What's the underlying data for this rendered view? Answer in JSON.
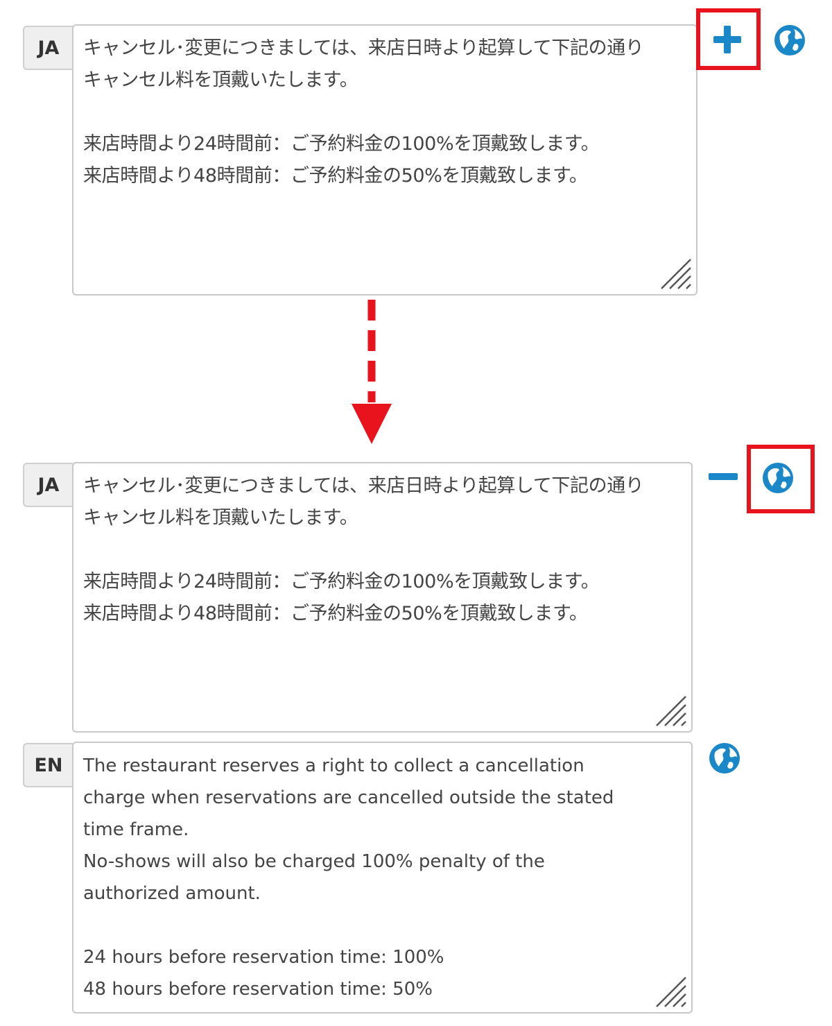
{
  "colors": {
    "highlight": "#e8131d",
    "arrow": "#e8131d",
    "icon": "#1a87c9",
    "tag_bg": "#efefef",
    "border": "#c8c8c8"
  },
  "top": {
    "lang": "JA",
    "text": "キャンセル･変更につきましては、来店日時より起算して下記の通り\nキャンセル料を頂戴いたします。\n\n来店時間より24時間前：ご予約料金の100%を頂戴致します。\n来店時間より48時間前：ご予約料金の50%を頂戴致します。",
    "add_icon": "plus-icon",
    "globe_icon": "globe-icon"
  },
  "bottom_ja": {
    "lang": "JA",
    "text": "キャンセル･変更につきましては、来店日時より起算して下記の通り\nキャンセル料を頂戴いたします。\n\n来店時間より24時間前：ご予約料金の100%を頂戴致します。\n来店時間より48時間前：ご予約料金の50%を頂戴致します。",
    "remove_icon": "minus-icon",
    "globe_icon": "globe-icon"
  },
  "bottom_en": {
    "lang": "EN",
    "text": "The restaurant reserves a right to collect a cancellation\ncharge when reservations are cancelled outside the stated\ntime frame.\nNo-shows will also be charged 100% penalty of the\nauthorized amount.\n\n24 hours before reservation time: 100%\n48 hours before reservation time: 50%",
    "globe_icon": "globe-icon"
  }
}
